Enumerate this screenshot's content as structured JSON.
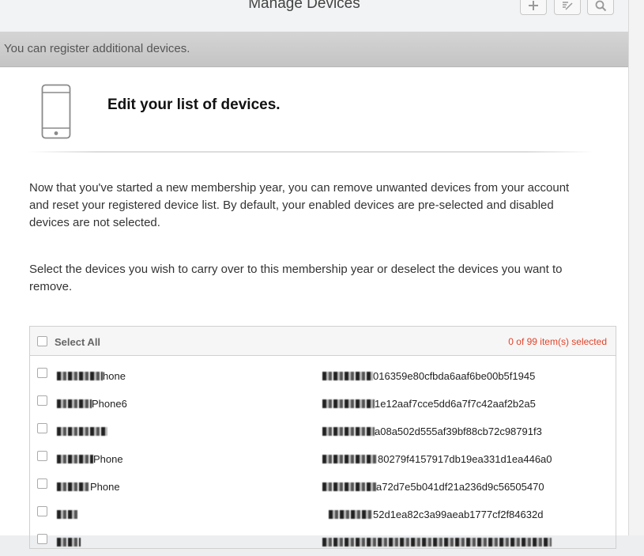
{
  "header": {
    "title": "Manage Devices",
    "buttons": [
      {
        "icon": "plus-icon"
      },
      {
        "icon": "edit-icon"
      },
      {
        "icon": "search-icon"
      }
    ]
  },
  "notice": "You can register additional devices.",
  "main": {
    "icon": "phone-icon",
    "heading": "Edit your list of devices.",
    "paragraph1": "Now that you've started a new membership year, you can remove unwanted devices from your account and reset your registered device list. By default, your enabled devices are pre-selected and disabled devices are not selected.",
    "paragraph2": "Select the devices you wish to carry over to this membership year or deselect the devices you want to remove."
  },
  "table": {
    "select_all_label": "Select All",
    "selection_count": "0 of 99 item(s) selected",
    "rows": [
      {
        "name_visible": "hone",
        "id_visible": "016359e80cfbda6aaf6be00b5f1945"
      },
      {
        "name_visible": "Phone6",
        "id_visible": "1e12aaf7cce5dd6a7f7c42aaf2b2a5"
      },
      {
        "name_visible": "",
        "id_visible": "a08a502d555af39bf88cb72c98791f3"
      },
      {
        "name_visible": "Phone",
        "id_visible": "80279f4157917db19ea331d1ea446a0"
      },
      {
        "name_visible": "Phone",
        "id_visible": "a72d7e5b041df21a236d9c56505470"
      },
      {
        "name_visible": "",
        "id_visible": "52d1ea82c3a99aeab1777cf2f84632d"
      }
    ]
  }
}
